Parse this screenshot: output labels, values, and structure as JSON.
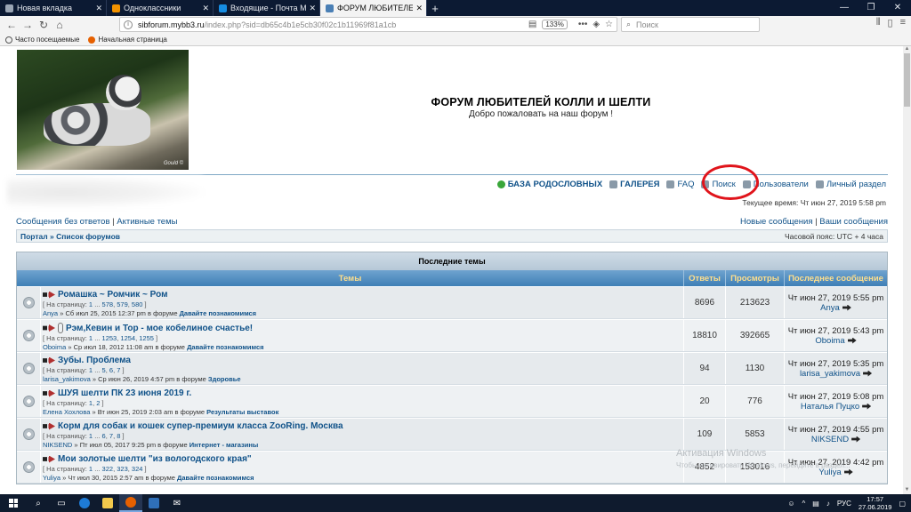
{
  "browser": {
    "tabs": [
      {
        "title": "Новая вкладка",
        "active": false,
        "color": "#9aa5b4"
      },
      {
        "title": "Одноклассники",
        "active": false,
        "color": "#f29200"
      },
      {
        "title": "Входящие - Почта Mail.ru",
        "active": false,
        "color": "#168de2"
      },
      {
        "title": "ФОРУМ ЛЮБИТЕЛЕЙ КОЛЛИ",
        "active": true,
        "color": "#4a7fb5"
      }
    ],
    "new_tab_label": "+",
    "address": {
      "host": "sibforum.mybb3.ru",
      "rest": "/index.php?sid=db65c4b1e5cb30f02c1b11969f81a1cb",
      "prefix": "sib"
    },
    "zoom": "133%",
    "search_placeholder": "Поиск",
    "bookmarks": [
      {
        "label": "Часто посещаемые"
      },
      {
        "label": "Начальная страница"
      }
    ]
  },
  "forum": {
    "title": "ФОРУМ ЛЮБИТЕЛЕЙ КОЛЛИ И ШЕЛТИ",
    "subtitle": "Добро пожаловать на наш форум !",
    "image_signature": "Gould ©",
    "topnav": [
      {
        "label": "БАЗА РОДОСЛОВНЫХ",
        "bold": true,
        "icon": "pedigree-icon"
      },
      {
        "label": "ГАЛЕРЕЯ",
        "bold": true,
        "icon": "gallery-icon"
      },
      {
        "label": "FAQ",
        "bold": false,
        "icon": "faq-icon"
      },
      {
        "label": "Поиск",
        "bold": false,
        "icon": "search-icon"
      },
      {
        "label": "Пользователи",
        "bold": false,
        "icon": "users-icon"
      },
      {
        "label": "Личный раздел",
        "bold": false,
        "icon": "profile-icon"
      }
    ],
    "current_time": "Текущее время: Чт июн 27, 2019 5:58 pm",
    "left_links": [
      "Сообщения без ответов",
      "Активные темы"
    ],
    "right_links": [
      "Новые сообщения",
      "Ваши сообщения"
    ],
    "breadcrumb": [
      "Портал",
      "Список форумов"
    ],
    "breadcrumb_sep": "»",
    "link_sep": "|",
    "timezone": "Часовой пояс: UTC + 4 часа",
    "recent_title": "Последние темы",
    "columns": {
      "topics": "Темы",
      "replies": "Ответы",
      "views": "Просмотры",
      "last": "Последнее сообщение"
    },
    "topics": [
      {
        "title": "Ромашка ~ Ромчик ~ Ром",
        "attachment": false,
        "pages": [
          "1",
          "578",
          "579",
          "580"
        ],
        "author": "Anya",
        "date": "Сб июл 25, 2015 12:37 pm",
        "forum": "Давайте познакомимся",
        "replies": "8696",
        "views": "213623",
        "last_date": "Чт июн 27, 2019 5:55 pm",
        "last_author": "Anya"
      },
      {
        "title": "Рэм,Кевин и Тор - мое кобелиное счастье!",
        "attachment": true,
        "pages": [
          "1",
          "1253",
          "1254",
          "1255"
        ],
        "author": "Oboima",
        "date": "Ср июл 18, 2012 11:08 am",
        "forum": "Давайте познакомимся",
        "replies": "18810",
        "views": "392665",
        "last_date": "Чт июн 27, 2019 5:43 pm",
        "last_author": "Oboima"
      },
      {
        "title": "Зубы. Проблема",
        "attachment": false,
        "pages": [
          "1",
          "5",
          "6",
          "7"
        ],
        "author": "larisa_yakimova",
        "date": "Ср июн 26, 2019 4:57 pm",
        "forum": "Здоровье",
        "replies": "94",
        "views": "1130",
        "last_date": "Чт июн 27, 2019 5:35 pm",
        "last_author": "larisa_yakimova"
      },
      {
        "title": "ШУЯ шелти ПК 23 июня 2019 г.",
        "attachment": false,
        "pages": [
          "1",
          "2"
        ],
        "author": "Елена Хохлова",
        "date": "Вт июн 25, 2019 2:03 am",
        "forum": "Результаты выставок",
        "replies": "20",
        "views": "776",
        "last_date": "Чт июн 27, 2019 5:08 pm",
        "last_author": "Наталья Пуцко"
      },
      {
        "title": "Корм для собак и кошек супер-премиум класса ZooRing. Москва",
        "attachment": false,
        "pages": [
          "1",
          "6",
          "7",
          "8"
        ],
        "author": "NIKSEND",
        "date": "Пт июл 05, 2017 9:25 pm",
        "forum": "Интернет - магазины",
        "replies": "109",
        "views": "5853",
        "last_date": "Чт июн 27, 2019 4:55 pm",
        "last_author": "NIKSEND"
      },
      {
        "title": "Мои золотые шелти \"из вологодского края\"",
        "attachment": false,
        "pages": [
          "1",
          "322",
          "323",
          "324"
        ],
        "author": "Yuliya",
        "date": "Чт июл 30, 2015 2:57 am",
        "forum": "Давайте познакомимся",
        "replies": "4852",
        "views": "153016",
        "last_date": "Чт июн 27, 2019 4:42 pm",
        "last_author": "Yuliya"
      }
    ],
    "pages_prefix": "[ На страницу: ",
    "pages_suffix": " ]",
    "ellipsis": "...",
    "meta_mid": " » ",
    "meta_in": " в форуме ",
    "activation_title": "Активация Windows",
    "activation_text": "Чтобы активировать Windows, перейдите в раздел..."
  },
  "taskbar": {
    "lang": "РУС",
    "time": "17:57",
    "date": "27.06.2019"
  }
}
